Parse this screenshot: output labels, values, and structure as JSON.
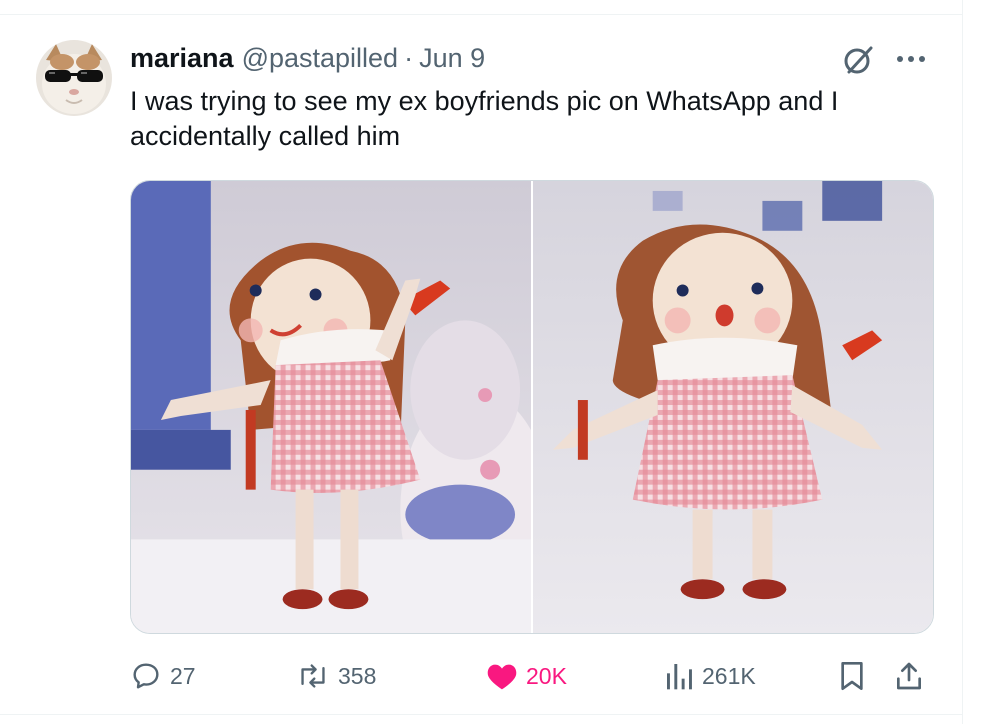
{
  "tweet": {
    "author": {
      "display_name": "mariana",
      "handle": "@pastapilled"
    },
    "separator": "·",
    "date": "Jun 9",
    "text": "I was trying to see my ex boyfriends pic on WhatsApp and I accidentally called him",
    "media": [
      {
        "description": "doll-waving-smiling"
      },
      {
        "description": "doll-surprised-mouth-open"
      }
    ]
  },
  "metrics": {
    "replies": "27",
    "retweets": "358",
    "likes": "20K",
    "views": "261K"
  },
  "colors": {
    "like_active": "#f91880",
    "muted_text": "#536471",
    "primary_text": "#0f1419",
    "border": "#cfd9de"
  },
  "icons": [
    "grok-icon",
    "more-icon",
    "reply-icon",
    "retweet-icon",
    "heart-icon",
    "views-icon",
    "bookmark-icon",
    "share-icon"
  ]
}
